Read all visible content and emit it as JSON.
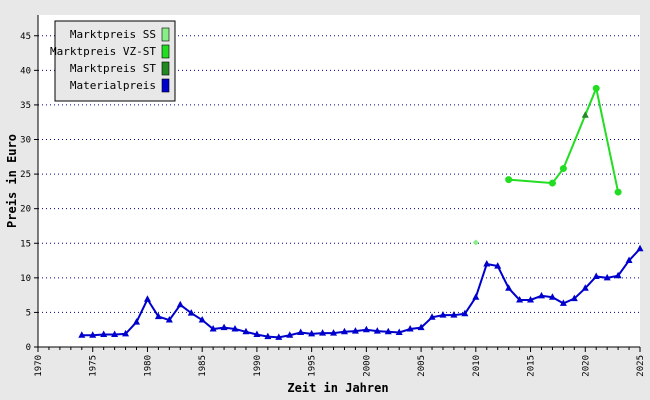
{
  "chart_data": {
    "type": "line",
    "xlabel": "Zeit in Jahren",
    "ylabel": "Preis in Euro",
    "xlim": [
      1970,
      2025
    ],
    "ylim": [
      0,
      48
    ],
    "x_ticks": [
      1970,
      1975,
      1980,
      1985,
      1990,
      1995,
      2000,
      2005,
      2010,
      2015,
      2020,
      2025
    ],
    "y_ticks": [
      0,
      5,
      10,
      15,
      20,
      25,
      30,
      35,
      40,
      45
    ],
    "grid": "horizontal-dotted",
    "legend_position": "top-left",
    "series": [
      {
        "name": "Marktpreis SS",
        "color": "#88ee88",
        "marker": "diamond",
        "points": [
          [
            2010,
            15.1
          ]
        ]
      },
      {
        "name": "Marktpreis VZ-ST",
        "color": "#22dd22",
        "marker": "circle",
        "points": [
          [
            2013,
            24.2
          ],
          [
            2017,
            23.7
          ],
          [
            2018,
            25.8
          ],
          [
            2021,
            37.4
          ],
          [
            2023,
            22.4
          ]
        ]
      },
      {
        "name": "Marktpreis ST",
        "color": "#228822",
        "marker": "triangle",
        "points": [
          [
            2020,
            33.5
          ]
        ]
      },
      {
        "name": "Materialpreis",
        "color": "#0000cc",
        "marker": "triangle",
        "points": [
          [
            1974,
            1.7
          ],
          [
            1975,
            1.7
          ],
          [
            1976,
            1.8
          ],
          [
            1977,
            1.8
          ],
          [
            1978,
            1.9
          ],
          [
            1979,
            3.6
          ],
          [
            1980,
            6.9
          ],
          [
            1981,
            4.4
          ],
          [
            1982,
            3.9
          ],
          [
            1983,
            6.1
          ],
          [
            1984,
            4.9
          ],
          [
            1985,
            3.9
          ],
          [
            1986,
            2.6
          ],
          [
            1987,
            2.8
          ],
          [
            1988,
            2.6
          ],
          [
            1989,
            2.2
          ],
          [
            1990,
            1.8
          ],
          [
            1991,
            1.5
          ],
          [
            1992,
            1.4
          ],
          [
            1993,
            1.7
          ],
          [
            1994,
            2.1
          ],
          [
            1995,
            1.9
          ],
          [
            1996,
            2.0
          ],
          [
            1997,
            2.0
          ],
          [
            1998,
            2.2
          ],
          [
            1999,
            2.3
          ],
          [
            2000,
            2.5
          ],
          [
            2001,
            2.3
          ],
          [
            2002,
            2.2
          ],
          [
            2003,
            2.1
          ],
          [
            2004,
            2.6
          ],
          [
            2005,
            2.8
          ],
          [
            2006,
            4.3
          ],
          [
            2007,
            4.6
          ],
          [
            2008,
            4.6
          ],
          [
            2009,
            4.8
          ],
          [
            2010,
            7.2
          ],
          [
            2011,
            12.0
          ],
          [
            2012,
            11.7
          ],
          [
            2013,
            8.5
          ],
          [
            2014,
            6.8
          ],
          [
            2015,
            6.8
          ],
          [
            2016,
            7.4
          ],
          [
            2017,
            7.2
          ],
          [
            2018,
            6.3
          ],
          [
            2019,
            7.0
          ],
          [
            2020,
            8.5
          ],
          [
            2021,
            10.2
          ],
          [
            2022,
            10.0
          ],
          [
            2023,
            10.3
          ],
          [
            2024,
            12.5
          ],
          [
            2025,
            14.2
          ]
        ]
      }
    ]
  }
}
